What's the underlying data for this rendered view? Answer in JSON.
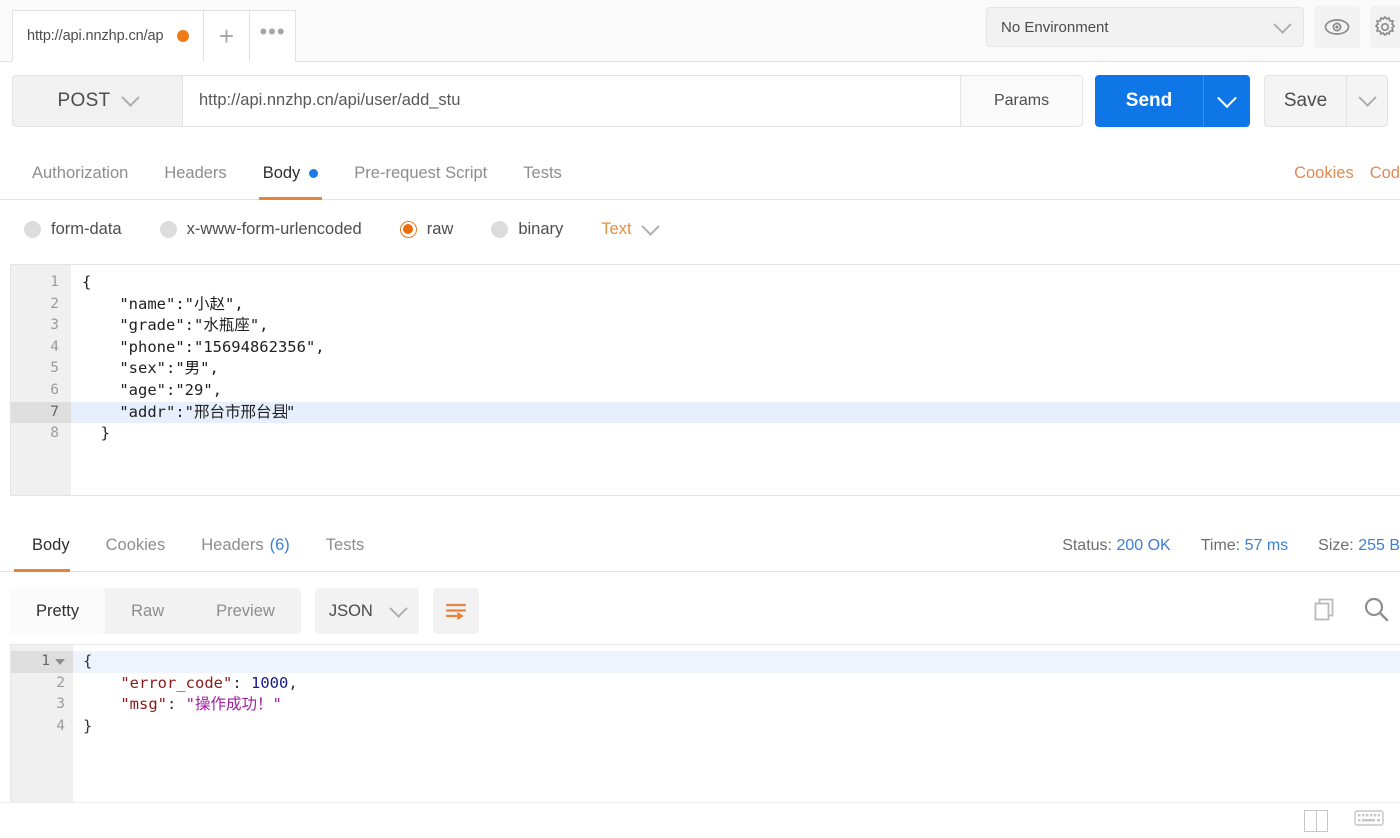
{
  "tab_bar": {
    "request_tab_title": "http://api.nnzhp.cn/ap",
    "unsaved_indicator": "unsaved-dot",
    "new_tab_label": "+",
    "more_label": "•••",
    "environment": {
      "selected": "No Environment",
      "chevron": "chevron-down-icon"
    },
    "eye_icon": "eye-icon",
    "settings_icon": "gear-icon"
  },
  "request": {
    "method": "POST",
    "url": "http://api.nnzhp.cn/api/user/add_stu",
    "params_label": "Params",
    "send_label": "Send",
    "save_label": "Save",
    "tabs": [
      {
        "label": "Authorization",
        "active": false,
        "dot": false
      },
      {
        "label": "Headers",
        "active": false,
        "dot": false
      },
      {
        "label": "Body",
        "active": true,
        "dot": true
      },
      {
        "label": "Pre-request Script",
        "active": false,
        "dot": false
      },
      {
        "label": "Tests",
        "active": false,
        "dot": false
      }
    ],
    "links": [
      {
        "label": "Cookies"
      },
      {
        "label": "Cod"
      }
    ],
    "body_types": [
      {
        "label": "form-data",
        "selected": false
      },
      {
        "label": "x-www-form-urlencoded",
        "selected": false
      },
      {
        "label": "raw",
        "selected": true
      },
      {
        "label": "binary",
        "selected": false
      }
    ],
    "raw_format": "Text",
    "body_lines": [
      {
        "n": "1",
        "text": "{",
        "current": false
      },
      {
        "n": "2",
        "text": "    \"name\":\"小赵\",",
        "current": false
      },
      {
        "n": "3",
        "text": "    \"grade\":\"水瓶座\",",
        "current": false
      },
      {
        "n": "4",
        "text": "    \"phone\":\"15694862356\",",
        "current": false
      },
      {
        "n": "5",
        "text": "    \"sex\":\"男\",",
        "current": false
      },
      {
        "n": "6",
        "text": "    \"age\":\"29\",",
        "current": false
      },
      {
        "n": "7",
        "text": "    \"addr\":\"邢台市邢台县\"",
        "current": true
      },
      {
        "n": "8",
        "text": "  }",
        "current": false
      }
    ]
  },
  "response": {
    "tabs": [
      {
        "label": "Body",
        "count": "",
        "active": true
      },
      {
        "label": "Cookies",
        "count": "",
        "active": false
      },
      {
        "label": "Headers",
        "count": "(6)",
        "active": false
      },
      {
        "label": "Tests",
        "count": "",
        "active": false
      }
    ],
    "status": {
      "status_label": "Status:",
      "status_value": "200 OK",
      "time_label": "Time:",
      "time_value": "57 ms",
      "size_label": "Size:",
      "size_value": "255 B"
    },
    "view_modes": [
      {
        "label": "Pretty",
        "active": true
      },
      {
        "label": "Raw",
        "active": false
      },
      {
        "label": "Preview",
        "active": false
      }
    ],
    "format": "JSON",
    "wrap_icon": "word-wrap-icon",
    "copy_icon": "copy-icon",
    "search_icon": "search-icon",
    "body_lines": [
      {
        "n": "1",
        "fold": true,
        "current": true,
        "segments": [
          {
            "t": "{",
            "c": "punc"
          }
        ]
      },
      {
        "n": "2",
        "fold": false,
        "current": false,
        "segments": [
          {
            "t": "    ",
            "c": "punc"
          },
          {
            "t": "\"error_code\"",
            "c": "k"
          },
          {
            "t": ": ",
            "c": "punc"
          },
          {
            "t": "1000",
            "c": "num"
          },
          {
            "t": ",",
            "c": "punc"
          }
        ]
      },
      {
        "n": "3",
        "fold": false,
        "current": false,
        "segments": [
          {
            "t": "    ",
            "c": "punc"
          },
          {
            "t": "\"msg\"",
            "c": "k"
          },
          {
            "t": ": ",
            "c": "punc"
          },
          {
            "t": "\"操作成功！\"",
            "c": "str"
          }
        ]
      },
      {
        "n": "4",
        "fold": false,
        "current": false,
        "segments": [
          {
            "t": "}",
            "c": "punc"
          }
        ]
      }
    ]
  },
  "bottom_bar": {
    "layout_icon": "two-pane-layout-icon",
    "keyboard_icon": "keyboard-icon"
  },
  "colors": {
    "accent_orange": "#e8833a",
    "send_blue": "#0f76e8",
    "link_blue": "#3a7fd5",
    "unsaved": "#ef7b18"
  }
}
